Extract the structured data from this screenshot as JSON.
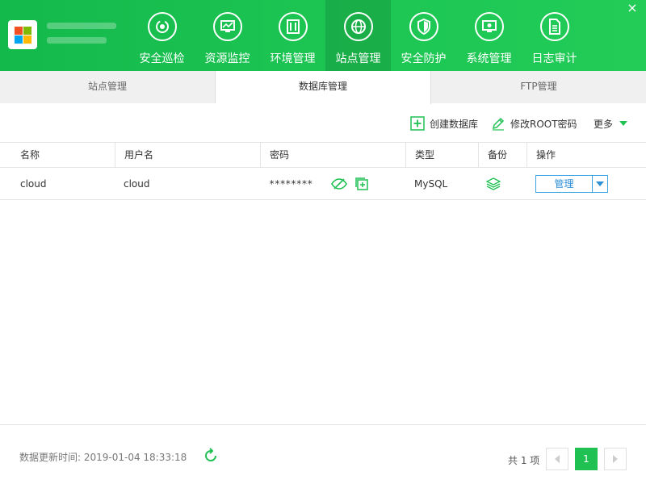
{
  "app": {
    "close_glyph": "×",
    "accent_color": "#1fc153",
    "link_color": "#2d8fd8"
  },
  "nav": {
    "items": [
      {
        "label": "安全巡检",
        "icon": "shield-scan-icon"
      },
      {
        "label": "资源监控",
        "icon": "monitor-chart-icon"
      },
      {
        "label": "环境管理",
        "icon": "server-stack-icon"
      },
      {
        "label": "站点管理",
        "icon": "globe-icon",
        "active": true
      },
      {
        "label": "安全防护",
        "icon": "shield-icon"
      },
      {
        "label": "系统管理",
        "icon": "settings-monitor-icon"
      },
      {
        "label": "日志审计",
        "icon": "document-icon"
      }
    ]
  },
  "tabs": [
    {
      "label": "站点管理"
    },
    {
      "label": "数据库管理",
      "active": true
    },
    {
      "label": "FTP管理"
    }
  ],
  "toolbar": {
    "create_label": "创建数据库",
    "root_label": "修改ROOT密码",
    "more_label": "更多"
  },
  "table": {
    "headers": [
      "名称",
      "用户名",
      "密码",
      "类型",
      "备份",
      "操作"
    ],
    "rows": [
      {
        "name": "cloud",
        "user": "cloud",
        "password": "********",
        "type": "MySQL",
        "action": "管理"
      }
    ]
  },
  "footer": {
    "update_text": "数据更新时间: 2019-01-04 18:33:18",
    "total_text": "共 1 项",
    "current_page": "1"
  }
}
